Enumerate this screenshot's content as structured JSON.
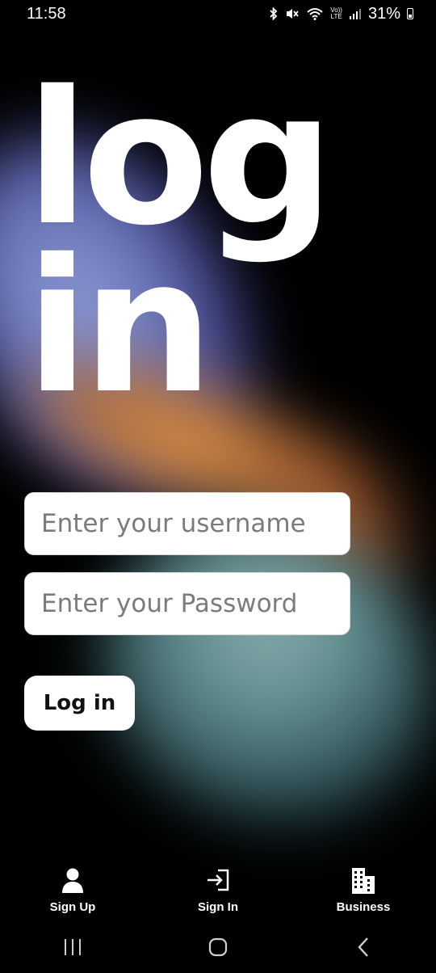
{
  "status_bar": {
    "time": "11:58",
    "lte_top": "Vo))",
    "lte_bottom": "LTE",
    "battery": "31%",
    "icons": [
      "bluetooth-icon",
      "mute-icon",
      "wifi-icon",
      "signal-icon",
      "battery-icon"
    ]
  },
  "hero": {
    "line1": "log",
    "line2": "in"
  },
  "form": {
    "username_placeholder": "Enter your username",
    "password_placeholder": "Enter your Password",
    "login_button": "Log in"
  },
  "bottom_nav": {
    "items": [
      {
        "label": "Sign Up",
        "icon": "user-icon"
      },
      {
        "label": "Sign In",
        "icon": "sign-in-icon"
      },
      {
        "label": "Business",
        "icon": "building-icon"
      }
    ]
  },
  "system_nav": {
    "icons": [
      "recent-apps-icon",
      "home-icon",
      "back-icon"
    ]
  },
  "colors": {
    "background": "#000000",
    "text": "#ffffff",
    "field_bg": "#ffffff"
  }
}
